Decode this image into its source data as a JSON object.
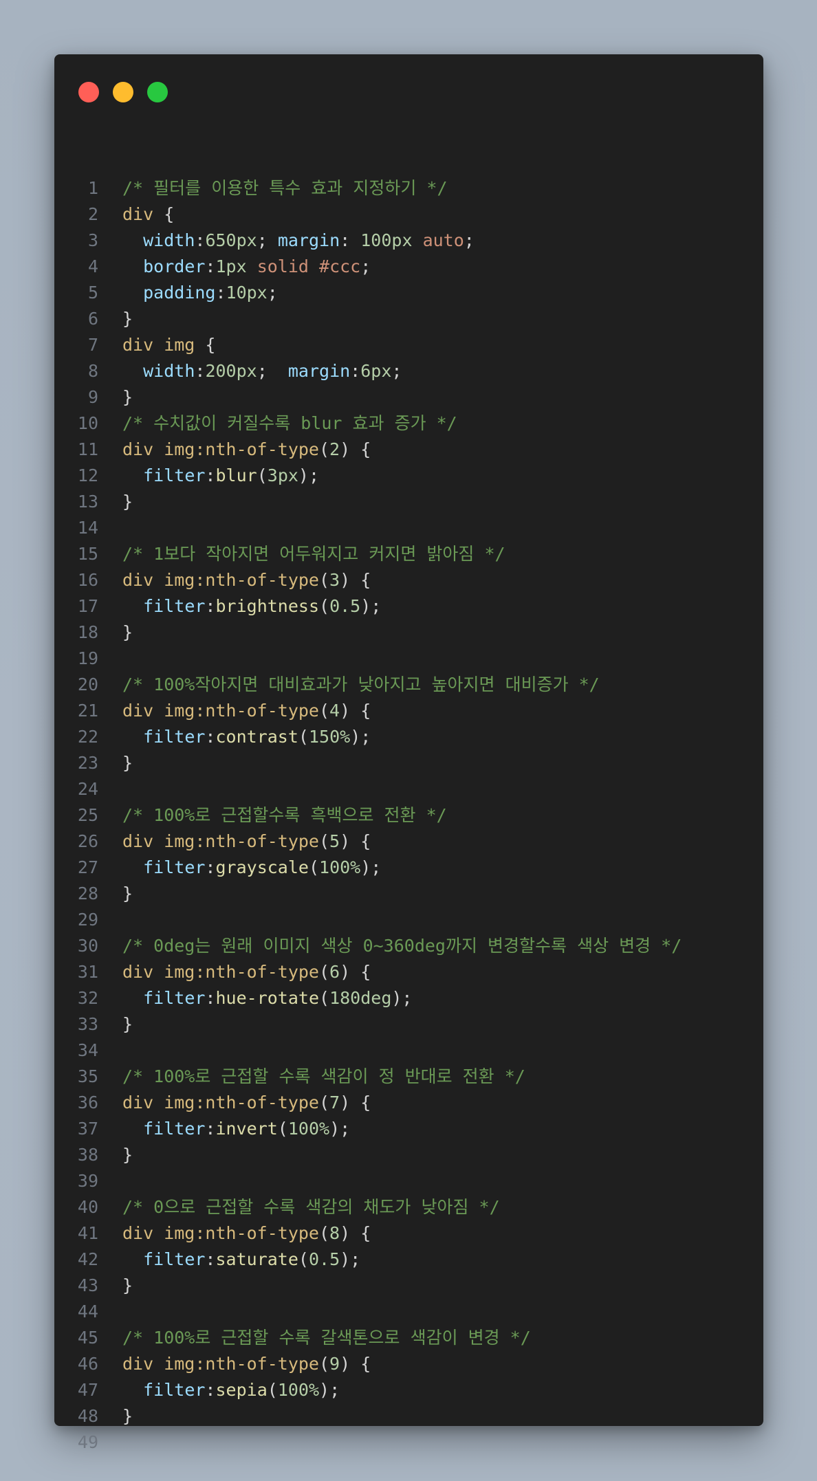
{
  "window": {
    "controls": [
      "close",
      "minimize",
      "maximize"
    ],
    "colors": {
      "close": "#ff5f57",
      "minimize": "#febc2e",
      "maximize": "#28c840",
      "background": "#1f1f1f",
      "comment": "#6a9955",
      "selector": "#d7ba7d",
      "property": "#9cdcfe",
      "number": "#b5cea8",
      "keyword": "#ce9178",
      "line_number": "#6f7680"
    }
  },
  "code": {
    "language": "css",
    "lines": [
      {
        "n": "1",
        "tokens": [
          [
            "comment",
            "/* 필터를 이용한 특수 효과 지정하기 */"
          ]
        ]
      },
      {
        "n": "2",
        "tokens": [
          [
            "selector",
            "div"
          ],
          [
            "brace",
            " {"
          ]
        ]
      },
      {
        "n": "3",
        "tokens": [
          [
            "plain",
            "  "
          ],
          [
            "prop",
            "width"
          ],
          [
            "punct",
            ":"
          ],
          [
            "number",
            "650px"
          ],
          [
            "punct",
            "; "
          ],
          [
            "prop",
            "margin"
          ],
          [
            "punct",
            ": "
          ],
          [
            "number",
            "100px"
          ],
          [
            "plain",
            " "
          ],
          [
            "keyword",
            "auto"
          ],
          [
            "punct",
            ";"
          ]
        ]
      },
      {
        "n": "4",
        "tokens": [
          [
            "plain",
            "  "
          ],
          [
            "prop",
            "border"
          ],
          [
            "punct",
            ":"
          ],
          [
            "number",
            "1px"
          ],
          [
            "plain",
            " "
          ],
          [
            "keyword",
            "solid"
          ],
          [
            "plain",
            " "
          ],
          [
            "keyword",
            "#ccc"
          ],
          [
            "punct",
            ";"
          ]
        ]
      },
      {
        "n": "5",
        "tokens": [
          [
            "plain",
            "  "
          ],
          [
            "prop",
            "padding"
          ],
          [
            "punct",
            ":"
          ],
          [
            "number",
            "10px"
          ],
          [
            "punct",
            ";"
          ]
        ]
      },
      {
        "n": "6",
        "tokens": [
          [
            "brace",
            "}"
          ]
        ]
      },
      {
        "n": "7",
        "tokens": [
          [
            "selector",
            "div img"
          ],
          [
            "brace",
            " {"
          ]
        ]
      },
      {
        "n": "8",
        "tokens": [
          [
            "plain",
            "  "
          ],
          [
            "prop",
            "width"
          ],
          [
            "punct",
            ":"
          ],
          [
            "number",
            "200px"
          ],
          [
            "punct",
            ";  "
          ],
          [
            "prop",
            "margin"
          ],
          [
            "punct",
            ":"
          ],
          [
            "number",
            "6px"
          ],
          [
            "punct",
            ";"
          ]
        ]
      },
      {
        "n": "9",
        "tokens": [
          [
            "brace",
            "}"
          ]
        ]
      },
      {
        "n": "10",
        "tokens": [
          [
            "comment",
            "/* 수치값이 커질수록 blur 효과 증가 */"
          ]
        ]
      },
      {
        "n": "11",
        "tokens": [
          [
            "selector",
            "div img:nth-of-type"
          ],
          [
            "punct",
            "("
          ],
          [
            "number",
            "2"
          ],
          [
            "punct",
            ")"
          ],
          [
            "brace",
            " {"
          ]
        ]
      },
      {
        "n": "12",
        "tokens": [
          [
            "plain",
            "  "
          ],
          [
            "prop",
            "filter"
          ],
          [
            "punct",
            ":"
          ],
          [
            "func",
            "blur"
          ],
          [
            "punct",
            "("
          ],
          [
            "number",
            "3px"
          ],
          [
            "punct",
            ");"
          ]
        ]
      },
      {
        "n": "13",
        "tokens": [
          [
            "brace",
            "}"
          ]
        ]
      },
      {
        "n": "14",
        "tokens": []
      },
      {
        "n": "15",
        "tokens": [
          [
            "comment",
            "/* 1보다 작아지면 어두워지고 커지면 밝아짐 */"
          ]
        ]
      },
      {
        "n": "16",
        "tokens": [
          [
            "selector",
            "div img:nth-of-type"
          ],
          [
            "punct",
            "("
          ],
          [
            "number",
            "3"
          ],
          [
            "punct",
            ")"
          ],
          [
            "brace",
            " {"
          ]
        ]
      },
      {
        "n": "17",
        "tokens": [
          [
            "plain",
            "  "
          ],
          [
            "prop",
            "filter"
          ],
          [
            "punct",
            ":"
          ],
          [
            "func",
            "brightness"
          ],
          [
            "punct",
            "("
          ],
          [
            "number",
            "0.5"
          ],
          [
            "punct",
            ");"
          ]
        ]
      },
      {
        "n": "18",
        "tokens": [
          [
            "brace",
            "}"
          ]
        ]
      },
      {
        "n": "19",
        "tokens": []
      },
      {
        "n": "20",
        "tokens": [
          [
            "comment",
            "/* 100%작아지면 대비효과가 낮아지고 높아지면 대비증가 */"
          ]
        ]
      },
      {
        "n": "21",
        "tokens": [
          [
            "selector",
            "div img:nth-of-type"
          ],
          [
            "punct",
            "("
          ],
          [
            "number",
            "4"
          ],
          [
            "punct",
            ")"
          ],
          [
            "brace",
            " {"
          ]
        ]
      },
      {
        "n": "22",
        "tokens": [
          [
            "plain",
            "  "
          ],
          [
            "prop",
            "filter"
          ],
          [
            "punct",
            ":"
          ],
          [
            "func",
            "contrast"
          ],
          [
            "punct",
            "("
          ],
          [
            "number",
            "150%"
          ],
          [
            "punct",
            ");"
          ]
        ]
      },
      {
        "n": "23",
        "tokens": [
          [
            "brace",
            "}"
          ]
        ]
      },
      {
        "n": "24",
        "tokens": []
      },
      {
        "n": "25",
        "tokens": [
          [
            "comment",
            "/* 100%로 근접할수록 흑백으로 전환 */"
          ]
        ]
      },
      {
        "n": "26",
        "tokens": [
          [
            "selector",
            "div img:nth-of-type"
          ],
          [
            "punct",
            "("
          ],
          [
            "number",
            "5"
          ],
          [
            "punct",
            ")"
          ],
          [
            "brace",
            " {"
          ]
        ]
      },
      {
        "n": "27",
        "tokens": [
          [
            "plain",
            "  "
          ],
          [
            "prop",
            "filter"
          ],
          [
            "punct",
            ":"
          ],
          [
            "func",
            "grayscale"
          ],
          [
            "punct",
            "("
          ],
          [
            "number",
            "100%"
          ],
          [
            "punct",
            ");"
          ]
        ]
      },
      {
        "n": "28",
        "tokens": [
          [
            "brace",
            "}"
          ]
        ]
      },
      {
        "n": "29",
        "tokens": []
      },
      {
        "n": "30",
        "tokens": [
          [
            "comment",
            "/* 0deg는 원래 이미지 색상 0~360deg까지 변경할수록 색상 변경 */"
          ]
        ]
      },
      {
        "n": "31",
        "tokens": [
          [
            "selector",
            "div img:nth-of-type"
          ],
          [
            "punct",
            "("
          ],
          [
            "number",
            "6"
          ],
          [
            "punct",
            ")"
          ],
          [
            "brace",
            " {"
          ]
        ]
      },
      {
        "n": "32",
        "tokens": [
          [
            "plain",
            "  "
          ],
          [
            "prop",
            "filter"
          ],
          [
            "punct",
            ":"
          ],
          [
            "func",
            "hue-rotate"
          ],
          [
            "punct",
            "("
          ],
          [
            "number",
            "180deg"
          ],
          [
            "punct",
            ");"
          ]
        ]
      },
      {
        "n": "33",
        "tokens": [
          [
            "brace",
            "}"
          ]
        ]
      },
      {
        "n": "34",
        "tokens": []
      },
      {
        "n": "35",
        "tokens": [
          [
            "comment",
            "/* 100%로 근접할 수록 색감이 정 반대로 전환 */"
          ]
        ]
      },
      {
        "n": "36",
        "tokens": [
          [
            "selector",
            "div img:nth-of-type"
          ],
          [
            "punct",
            "("
          ],
          [
            "number",
            "7"
          ],
          [
            "punct",
            ")"
          ],
          [
            "brace",
            " {"
          ]
        ]
      },
      {
        "n": "37",
        "tokens": [
          [
            "plain",
            "  "
          ],
          [
            "prop",
            "filter"
          ],
          [
            "punct",
            ":"
          ],
          [
            "func",
            "invert"
          ],
          [
            "punct",
            "("
          ],
          [
            "number",
            "100%"
          ],
          [
            "punct",
            ");"
          ]
        ]
      },
      {
        "n": "38",
        "tokens": [
          [
            "brace",
            "}"
          ]
        ]
      },
      {
        "n": "39",
        "tokens": []
      },
      {
        "n": "40",
        "tokens": [
          [
            "comment",
            "/* 0으로 근접할 수록 색감의 채도가 낮아짐 */"
          ]
        ]
      },
      {
        "n": "41",
        "tokens": [
          [
            "selector",
            "div img:nth-of-type"
          ],
          [
            "punct",
            "("
          ],
          [
            "number",
            "8"
          ],
          [
            "punct",
            ")"
          ],
          [
            "brace",
            " {"
          ]
        ]
      },
      {
        "n": "42",
        "tokens": [
          [
            "plain",
            "  "
          ],
          [
            "prop",
            "filter"
          ],
          [
            "punct",
            ":"
          ],
          [
            "func",
            "saturate"
          ],
          [
            "punct",
            "("
          ],
          [
            "number",
            "0.5"
          ],
          [
            "punct",
            ");"
          ]
        ]
      },
      {
        "n": "43",
        "tokens": [
          [
            "brace",
            "}"
          ]
        ]
      },
      {
        "n": "44",
        "tokens": []
      },
      {
        "n": "45",
        "tokens": [
          [
            "comment",
            "/* 100%로 근접할 수록 갈색톤으로 색감이 변경 */"
          ]
        ]
      },
      {
        "n": "46",
        "tokens": [
          [
            "selector",
            "div img:nth-of-type"
          ],
          [
            "punct",
            "("
          ],
          [
            "number",
            "9"
          ],
          [
            "punct",
            ")"
          ],
          [
            "brace",
            " {"
          ]
        ]
      },
      {
        "n": "47",
        "tokens": [
          [
            "plain",
            "  "
          ],
          [
            "prop",
            "filter"
          ],
          [
            "punct",
            ":"
          ],
          [
            "func",
            "sepia"
          ],
          [
            "punct",
            "("
          ],
          [
            "number",
            "100%"
          ],
          [
            "punct",
            ");"
          ]
        ]
      },
      {
        "n": "48",
        "tokens": [
          [
            "brace",
            "}"
          ]
        ]
      },
      {
        "n": "49",
        "tokens": []
      }
    ]
  }
}
